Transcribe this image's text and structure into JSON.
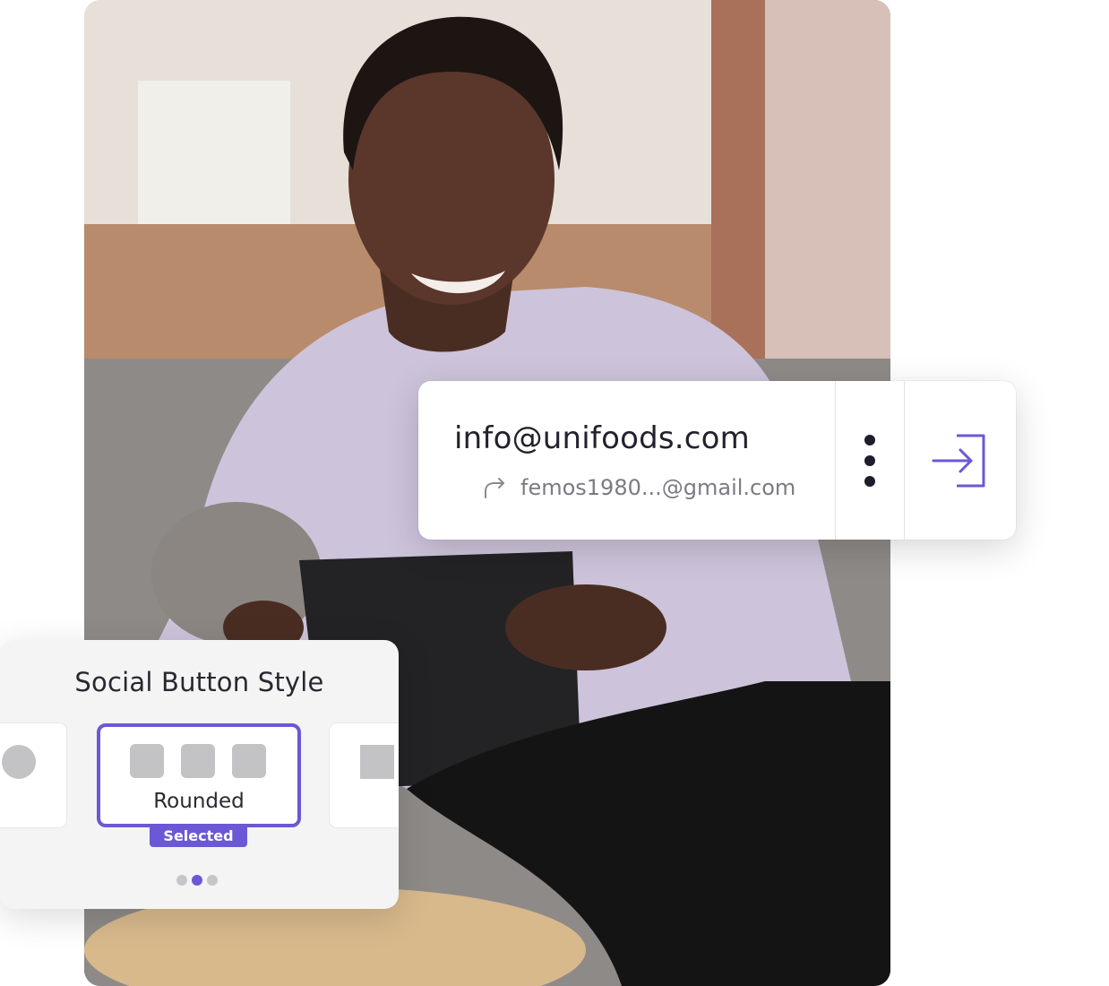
{
  "photo": {
    "description_icon": "person-with-tablet-photo"
  },
  "account": {
    "email": "info@unifoods.com",
    "forward_email": "femos1980...@gmail.com",
    "icons": {
      "forward": "forward-arrow-icon",
      "menu": "kebab-menu-icon",
      "signin": "sign-in-icon"
    }
  },
  "social_style": {
    "title": "Social Button Style",
    "options": [
      {
        "label": "",
        "shape": "circle"
      },
      {
        "label": "Rounded",
        "shape": "rounded",
        "selected": true
      },
      {
        "label": "",
        "shape": "square"
      }
    ],
    "selected_badge": "Selected",
    "pagination": {
      "pages": 3,
      "active": 2
    }
  },
  "colors": {
    "accent": "#6b58d6",
    "text_dark": "#24212d",
    "text_muted": "#7c7a82",
    "placeholder_shape": "#c3c3c6"
  }
}
